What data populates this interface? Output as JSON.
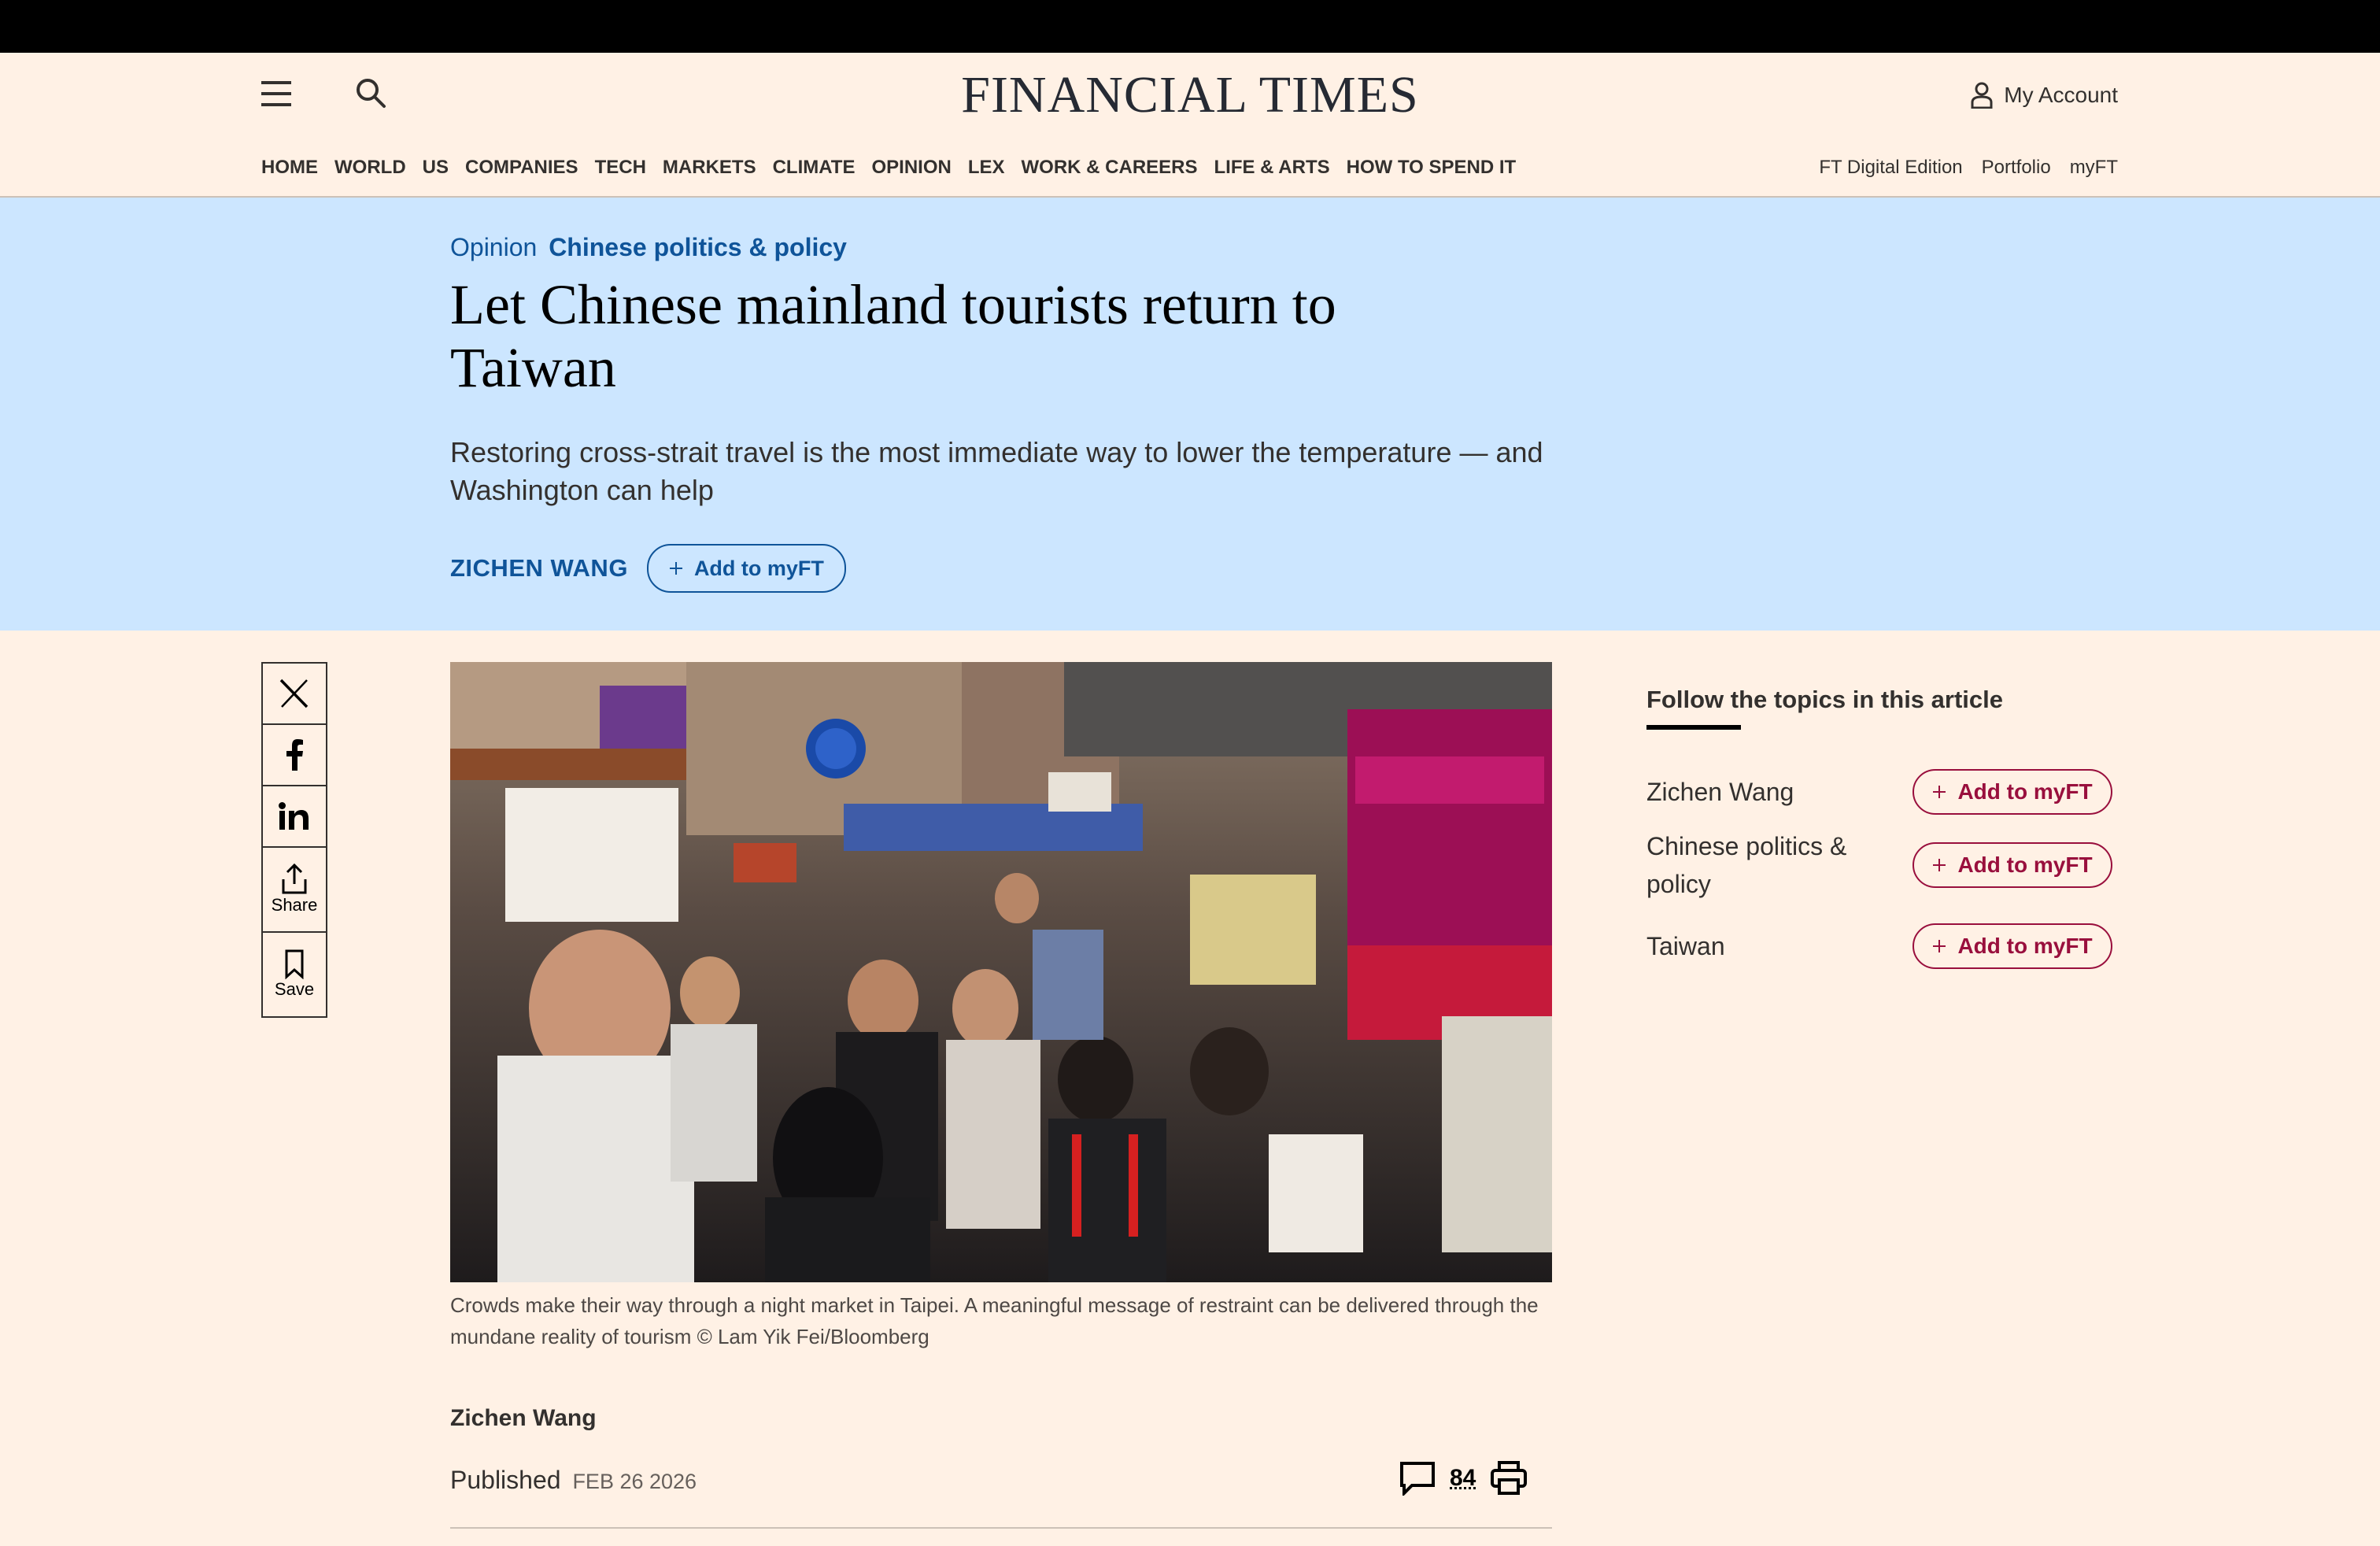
{
  "header": {
    "logo": "FINANCIAL TIMES",
    "account_label": "My Account"
  },
  "nav": {
    "items": [
      "HOME",
      "WORLD",
      "US",
      "COMPANIES",
      "TECH",
      "MARKETS",
      "CLIMATE",
      "OPINION",
      "LEX",
      "WORK & CAREERS",
      "LIFE & ARTS",
      "HOW TO SPEND IT"
    ],
    "right_items": [
      "FT Digital Edition",
      "Portfolio",
      "myFT"
    ]
  },
  "article": {
    "kicker_section": "Opinion",
    "kicker_topic": "Chinese politics & policy",
    "headline": "Let Chinese mainland tourists return to Taiwan",
    "standfirst": "Restoring cross-strait travel is the most immediate way to lower the temperature — and Washington can help",
    "author_link": "ZICHEN WANG",
    "add_myft_label": "Add to myFT",
    "caption": "Crowds make their way through a night market in Taipei. A meaningful message of restraint can be delivered through the mundane reality of tourism © Lam Yik Fei/Bloomberg",
    "author_name": "Zichen Wang",
    "published_label": "Published",
    "published_date": "FEB 26 2026",
    "comment_count": "84"
  },
  "share": {
    "share_label": "Share",
    "save_label": "Save"
  },
  "follow": {
    "title": "Follow the topics in this article",
    "topics": [
      {
        "name": "Zichen Wang",
        "button": "Add to myFT"
      },
      {
        "name": "Chinese politics & policy",
        "button": "Add to myFT"
      },
      {
        "name": "Taiwan",
        "button": "Add to myFT"
      }
    ]
  },
  "colors": {
    "page_bg": "#fff1e5",
    "hero_bg": "#cce6ff",
    "ft_blue": "#0f5499",
    "claret": "#990f3d"
  }
}
